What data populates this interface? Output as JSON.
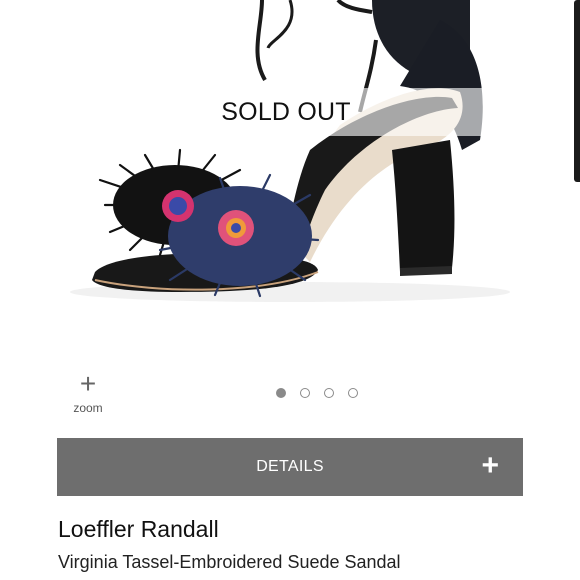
{
  "product_image": {
    "alt": "Virginia Tassel-Embroidered Suede Sandal"
  },
  "banner": {
    "status_text": "SOLD OUT"
  },
  "zoom": {
    "icon": "plus-icon",
    "label": "zoom"
  },
  "carousel": {
    "total": 4,
    "active_index": 0
  },
  "details": {
    "label": "DETAILS",
    "icon": "plus-icon"
  },
  "product": {
    "brand": "Loeffler Randall",
    "name": "Virginia Tassel-Embroidered Suede Sandal"
  },
  "colors": {
    "details_bg": "#6e6e6e",
    "dot": "#8a8a8a"
  }
}
